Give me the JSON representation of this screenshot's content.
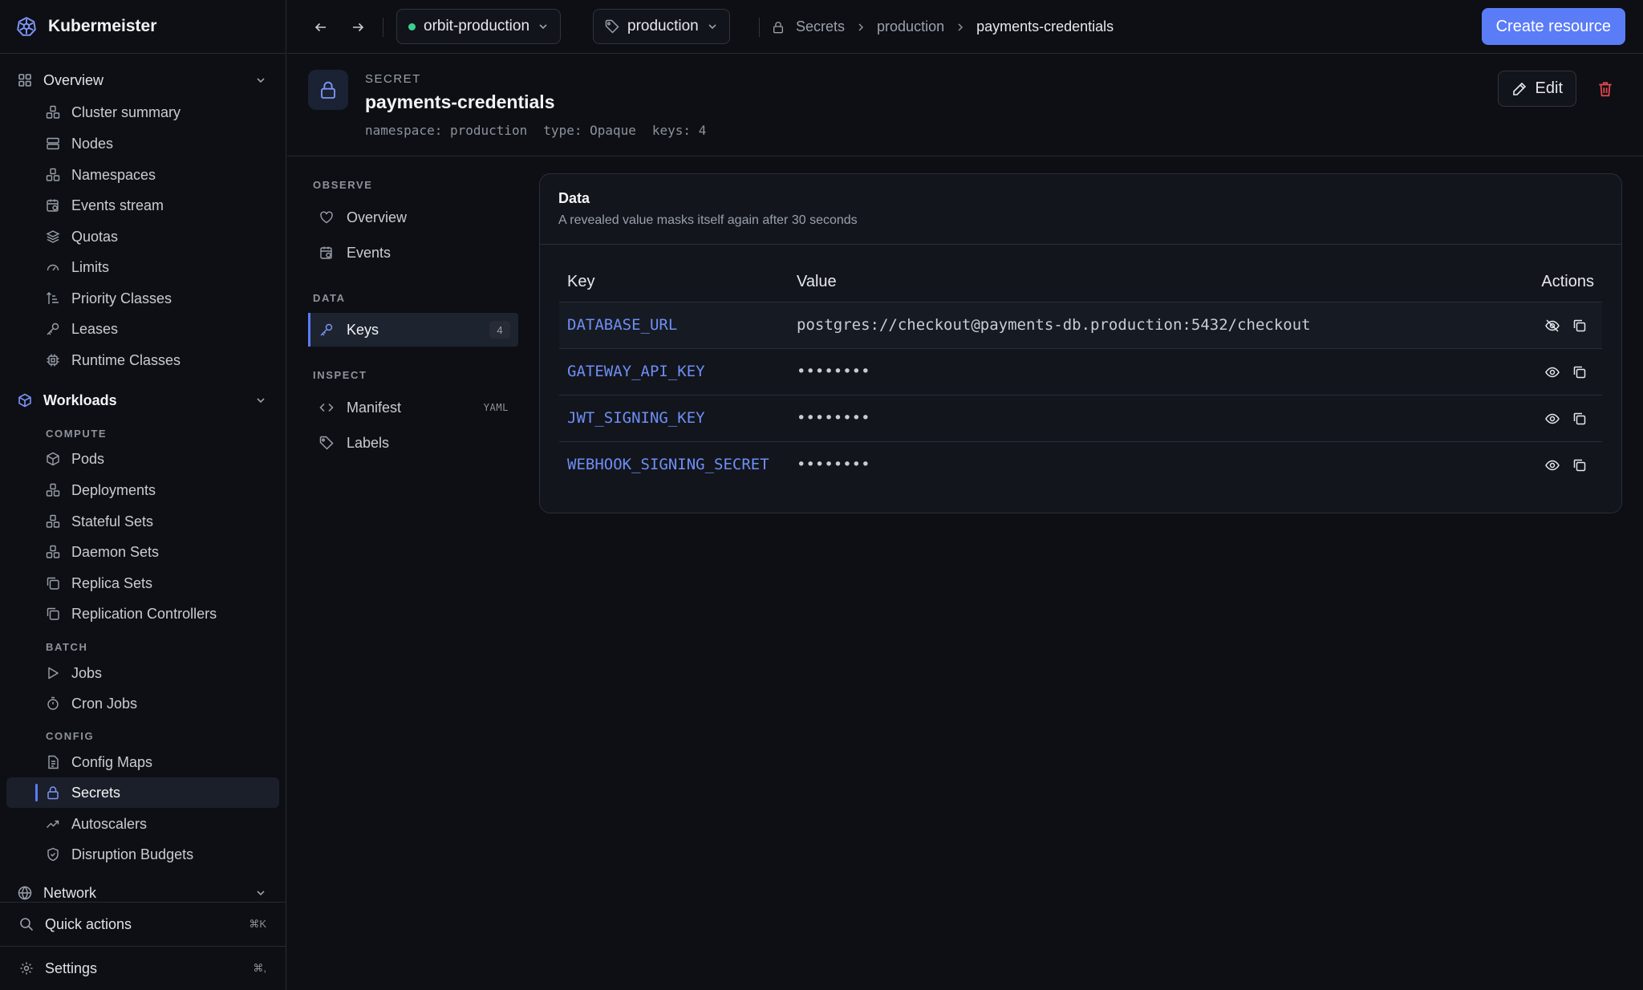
{
  "app": {
    "name": "Kubermeister"
  },
  "sidebar": {
    "overview": {
      "label": "Overview",
      "items": [
        {
          "label": "Cluster summary",
          "icon": "cluster-icon"
        },
        {
          "label": "Nodes",
          "icon": "server-icon"
        },
        {
          "label": "Namespaces",
          "icon": "cluster-icon"
        },
        {
          "label": "Events stream",
          "icon": "calendar-clock-icon"
        },
        {
          "label": "Quotas",
          "icon": "layers-icon"
        },
        {
          "label": "Limits",
          "icon": "gauge-icon"
        },
        {
          "label": "Priority Classes",
          "icon": "sort-icon"
        },
        {
          "label": "Leases",
          "icon": "key-icon"
        },
        {
          "label": "Runtime Classes",
          "icon": "chip-icon"
        }
      ]
    },
    "workloads": {
      "label": "Workloads",
      "compute_label": "COMPUTE",
      "compute": [
        {
          "label": "Pods",
          "icon": "box-icon"
        },
        {
          "label": "Deployments",
          "icon": "cluster-icon"
        },
        {
          "label": "Stateful Sets",
          "icon": "cluster-icon"
        },
        {
          "label": "Daemon Sets",
          "icon": "cluster-icon"
        },
        {
          "label": "Replica Sets",
          "icon": "copy-icon"
        },
        {
          "label": "Replication Controllers",
          "icon": "copy-icon"
        }
      ],
      "batch_label": "BATCH",
      "batch": [
        {
          "label": "Jobs",
          "icon": "play-icon"
        },
        {
          "label": "Cron Jobs",
          "icon": "timer-icon"
        }
      ],
      "config_label": "CONFIG",
      "config": [
        {
          "label": "Config Maps",
          "icon": "file-icon"
        },
        {
          "label": "Secrets",
          "icon": "lock-icon",
          "active": true
        },
        {
          "label": "Autoscalers",
          "icon": "trend-icon"
        },
        {
          "label": "Disruption Budgets",
          "icon": "shield-icon"
        }
      ]
    },
    "network": {
      "label": "Network"
    },
    "quick_actions": {
      "label": "Quick actions",
      "shortcut": "⌘K"
    },
    "settings": {
      "label": "Settings",
      "shortcut": "⌘,"
    }
  },
  "topbar": {
    "cluster": "orbit-production",
    "namespace": "production",
    "breadcrumb": [
      "Secrets",
      "production",
      "payments-credentials"
    ],
    "create_label": "Create resource"
  },
  "resource": {
    "kind": "SECRET",
    "name": "payments-credentials",
    "meta": [
      "namespace: production",
      "type: Opaque",
      "keys: 4"
    ],
    "edit_label": "Edit"
  },
  "subnav": {
    "observe_label": "OBSERVE",
    "overview_label": "Overview",
    "events_label": "Events",
    "data_label": "DATA",
    "keys_label": "Keys",
    "keys_count": "4",
    "inspect_label": "INSPECT",
    "manifest_label": "Manifest",
    "manifest_tag": "YAML",
    "labels_label": "Labels"
  },
  "card": {
    "title": "Data",
    "subtitle": "A revealed value masks itself again after 30 seconds",
    "col_key": "Key",
    "col_value": "Value",
    "col_actions": "Actions",
    "rows": [
      {
        "key": "DATABASE_URL",
        "value": "postgres://checkout@payments-db.production:5432/checkout",
        "revealed": true
      },
      {
        "key": "GATEWAY_API_KEY",
        "value": "••••••••",
        "revealed": false
      },
      {
        "key": "JWT_SIGNING_KEY",
        "value": "••••••••",
        "revealed": false
      },
      {
        "key": "WEBHOOK_SIGNING_SECRET",
        "value": "••••••••",
        "revealed": false
      }
    ]
  },
  "colors": {
    "accent": "#5b7cf7",
    "status_ok": "#3ecf8e",
    "danger": "#e5484d",
    "key_text": "#6f8ef5"
  }
}
